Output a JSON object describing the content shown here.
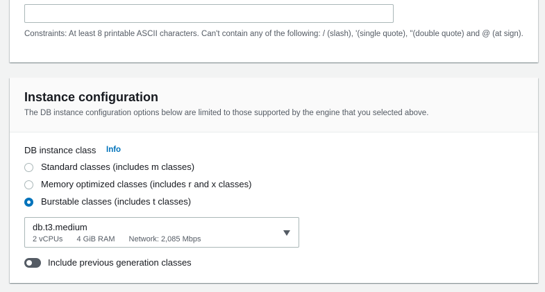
{
  "password_section": {
    "confirm_password_value": "",
    "constraints": "Constraints: At least 8 printable ASCII characters. Can't contain any of the following: / (slash), '(single quote), \"(double quote) and @ (at sign)."
  },
  "instance_configuration": {
    "title": "Instance configuration",
    "description": "The DB instance configuration options below are limited to those supported by the engine that you selected above.",
    "db_instance_class_label": "DB instance class",
    "info_label": "Info",
    "class_options": [
      {
        "label": "Standard classes (includes m classes)",
        "selected": false
      },
      {
        "label": "Memory optimized classes (includes r and x classes)",
        "selected": false
      },
      {
        "label": "Burstable classes (includes t classes)",
        "selected": true
      }
    ],
    "instance_select": {
      "value": "db.t3.medium",
      "vcpus": "2 vCPUs",
      "ram": "4 GiB RAM",
      "network": "Network: 2,085 Mbps"
    },
    "previous_generation_toggle": {
      "label": "Include previous generation classes",
      "enabled": false
    }
  },
  "colors": {
    "accent": "#0073bb",
    "text": "#16191f",
    "secondary_text": "#545b64",
    "background": "#f2f3f3"
  },
  "icons": {
    "dropdown_caret": "caret-down-icon"
  }
}
